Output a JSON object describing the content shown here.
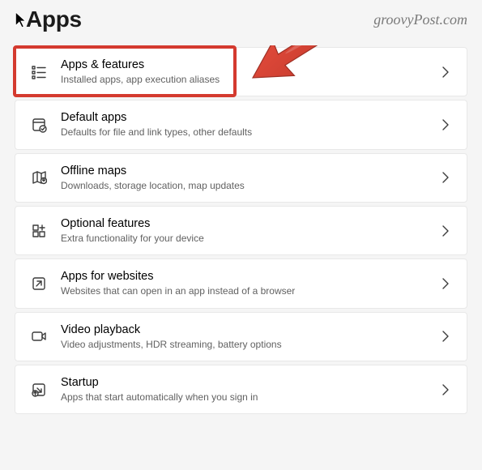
{
  "header": {
    "title": "Apps"
  },
  "watermark": "groovyPost.com",
  "items": [
    {
      "name": "apps-features",
      "icon": "list-icon",
      "label": "Apps & features",
      "desc": "Installed apps, app execution aliases"
    },
    {
      "name": "default-apps",
      "icon": "default-icon",
      "label": "Default apps",
      "desc": "Defaults for file and link types, other defaults"
    },
    {
      "name": "offline-maps",
      "icon": "map-icon",
      "label": "Offline maps",
      "desc": "Downloads, storage location, map updates"
    },
    {
      "name": "optional-features",
      "icon": "plus-grid-icon",
      "label": "Optional features",
      "desc": "Extra functionality for your device"
    },
    {
      "name": "apps-for-websites",
      "icon": "open-link-icon",
      "label": "Apps for websites",
      "desc": "Websites that can open in an app instead of a browser"
    },
    {
      "name": "video-playback",
      "icon": "video-icon",
      "label": "Video playback",
      "desc": "Video adjustments, HDR streaming, battery options"
    },
    {
      "name": "startup",
      "icon": "startup-icon",
      "label": "Startup",
      "desc": "Apps that start automatically when you sign in"
    }
  ],
  "annotation": {
    "highlight_color": "#d43a2f",
    "highlighted_item_index": 0
  }
}
